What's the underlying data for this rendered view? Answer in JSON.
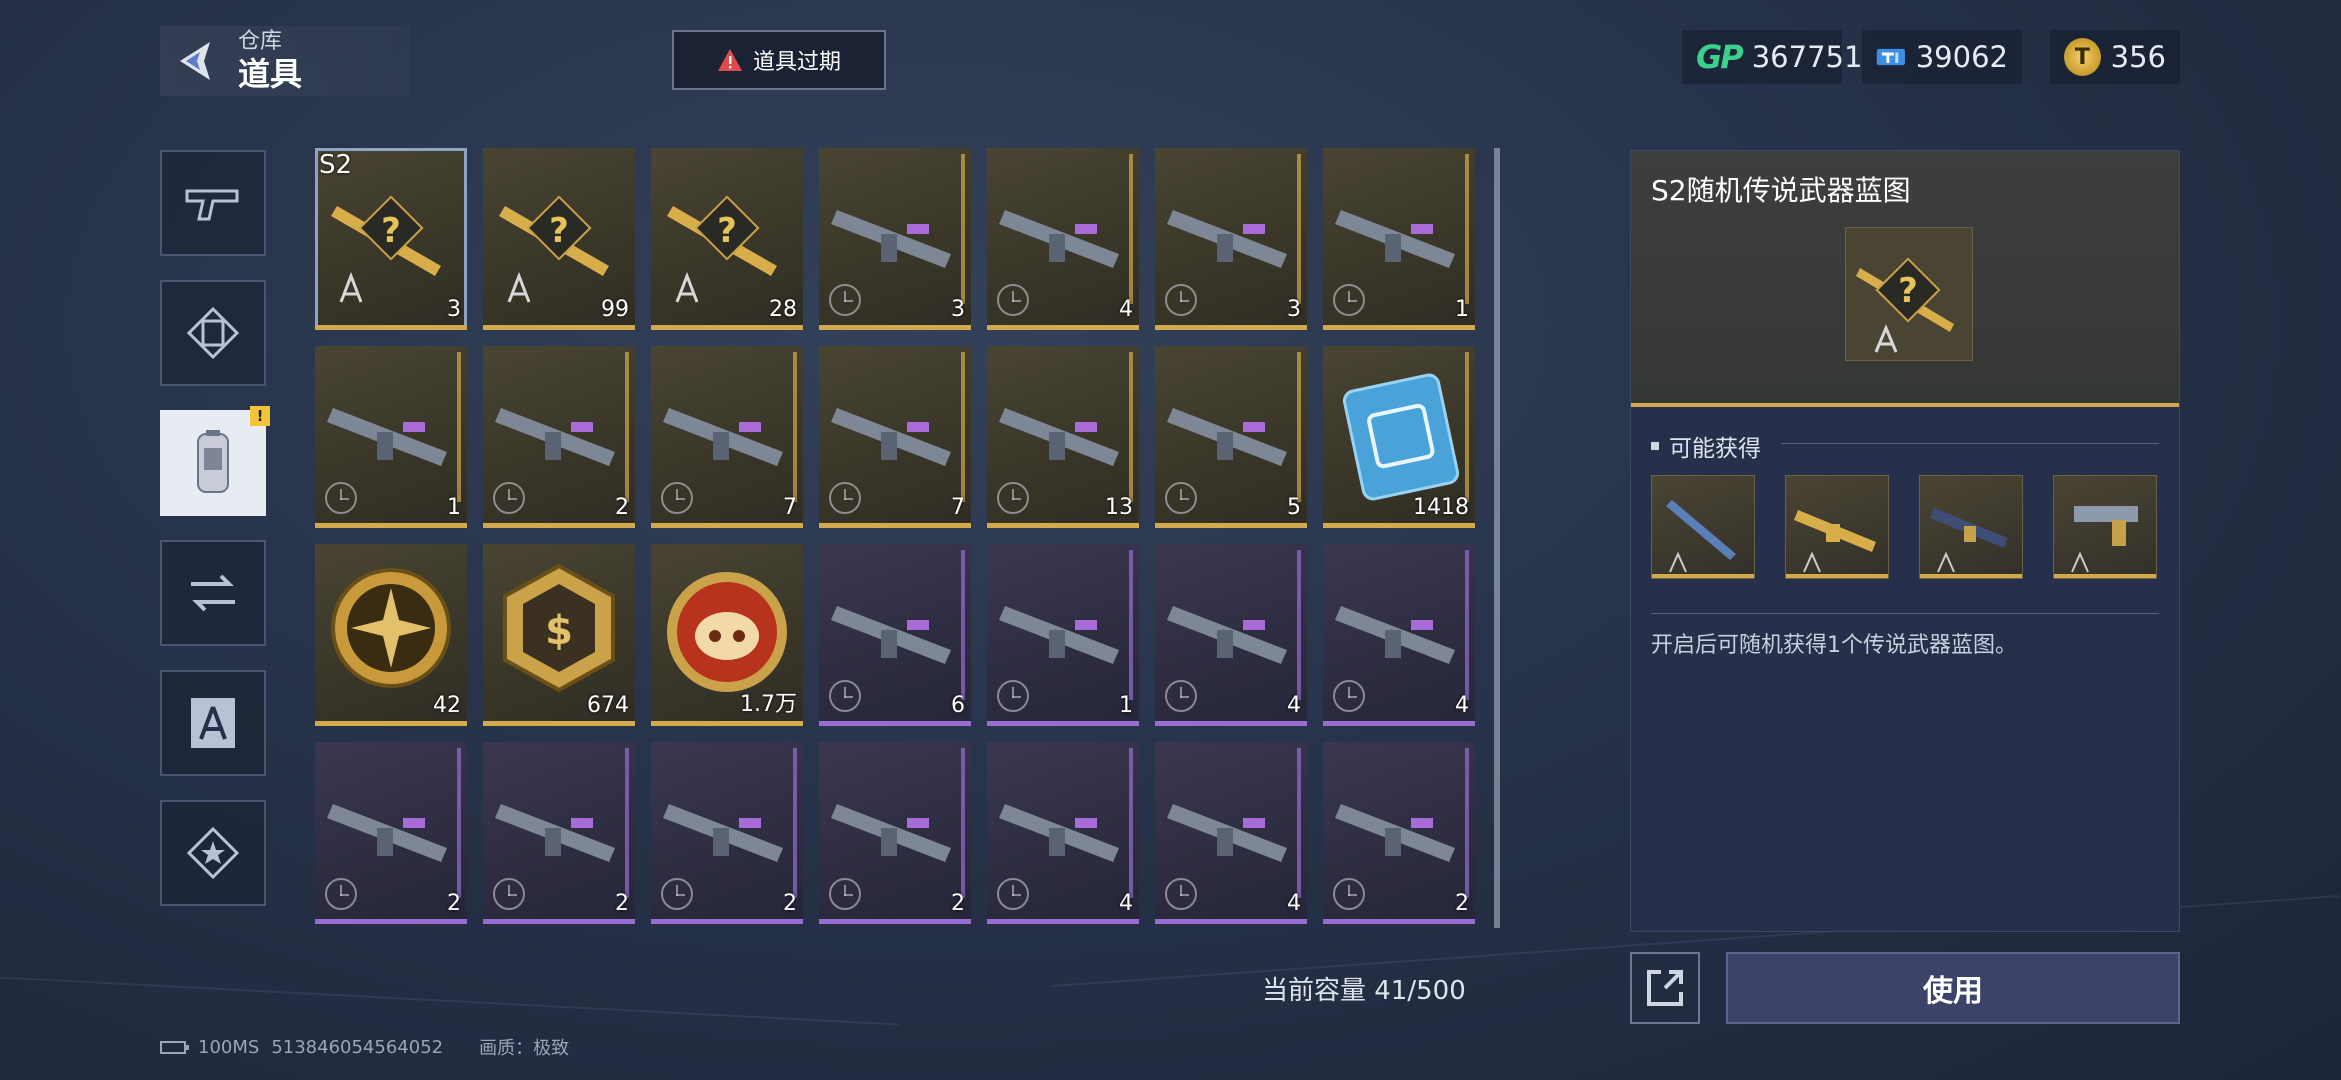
{
  "header": {
    "breadcrumb": "仓库",
    "title": "道具",
    "expire_button": "道具过期"
  },
  "currencies": [
    {
      "icon": "gp-icon",
      "label": "GP",
      "value": "367751"
    },
    {
      "icon": "ticket-icon",
      "value": "39062"
    },
    {
      "icon": "coin-icon",
      "value": "356"
    }
  ],
  "side_nav": [
    {
      "name": "side-tab-weapons",
      "icon": "pistol-icon"
    },
    {
      "name": "side-tab-skins",
      "icon": "skin-icon"
    },
    {
      "name": "side-tab-items",
      "icon": "canister-icon",
      "active": true,
      "badge": "!"
    },
    {
      "name": "side-tab-exchange",
      "icon": "exchange-icon"
    },
    {
      "name": "side-tab-blueprints",
      "icon": "blueprint-icon"
    },
    {
      "name": "side-tab-favorites",
      "icon": "star-icon"
    }
  ],
  "items": [
    {
      "tag": "S2",
      "count": "3",
      "rarity": "gold",
      "kind": "blueprint"
    },
    {
      "count": "99",
      "rarity": "gold",
      "kind": "blueprint"
    },
    {
      "count": "28",
      "rarity": "gold",
      "kind": "blueprint"
    },
    {
      "count": "3",
      "rarity": "gold",
      "kind": "weapon"
    },
    {
      "count": "4",
      "rarity": "gold",
      "kind": "weapon"
    },
    {
      "count": "3",
      "rarity": "gold",
      "kind": "weapon"
    },
    {
      "count": "1",
      "rarity": "gold",
      "kind": "weapon"
    },
    {
      "count": "1",
      "rarity": "gold",
      "kind": "weapon"
    },
    {
      "count": "2",
      "rarity": "gold",
      "kind": "weapon"
    },
    {
      "count": "7",
      "rarity": "gold",
      "kind": "weapon"
    },
    {
      "count": "7",
      "rarity": "gold",
      "kind": "weapon"
    },
    {
      "count": "13",
      "rarity": "gold",
      "kind": "weapon"
    },
    {
      "count": "5",
      "rarity": "gold",
      "kind": "weapon"
    },
    {
      "count": "1418",
      "rarity": "gold",
      "kind": "chip"
    },
    {
      "count": "42",
      "rarity": "gold",
      "kind": "medal"
    },
    {
      "count": "674",
      "rarity": "gold",
      "kind": "hexbadge"
    },
    {
      "count": "1.7万",
      "rarity": "gold",
      "kind": "pigcoin"
    },
    {
      "count": "6",
      "rarity": "purple",
      "kind": "weapon"
    },
    {
      "count": "1",
      "rarity": "purple",
      "kind": "weapon"
    },
    {
      "count": "4",
      "rarity": "purple",
      "kind": "weapon"
    },
    {
      "count": "4",
      "rarity": "purple",
      "kind": "weapon"
    },
    {
      "count": "2",
      "rarity": "purple",
      "kind": "weapon"
    },
    {
      "count": "2",
      "rarity": "purple",
      "kind": "weapon"
    },
    {
      "count": "2",
      "rarity": "purple",
      "kind": "weapon"
    },
    {
      "count": "2",
      "rarity": "purple",
      "kind": "weapon"
    },
    {
      "count": "4",
      "rarity": "purple",
      "kind": "weapon"
    },
    {
      "count": "4",
      "rarity": "purple",
      "kind": "weapon"
    },
    {
      "count": "2",
      "rarity": "purple",
      "kind": "weapon"
    }
  ],
  "capacity": "当前容量 41/500",
  "detail": {
    "title": "S2随机传说武器蓝图",
    "possible_heading": "可能获得",
    "description": "开启后可随机获得1个传说武器蓝图。",
    "use_button": "使用"
  },
  "status_bar": {
    "ping": "100MS",
    "uid": "513846054564052",
    "quality": "画质：极致"
  },
  "colors": {
    "gold_rarity": "#d3aa4b",
    "purple_rarity": "#9a6bd3",
    "gp_green": "#3bd08c"
  }
}
